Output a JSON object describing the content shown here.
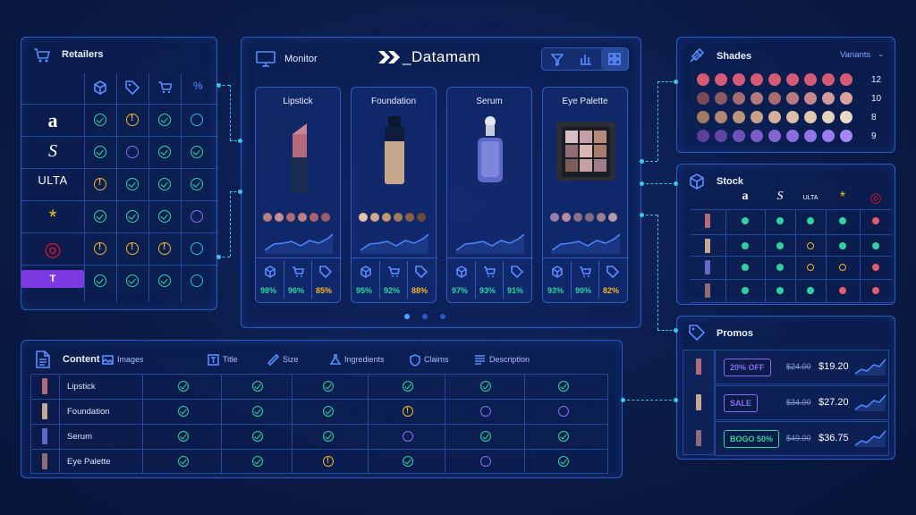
{
  "retailers": {
    "title": "Retailers",
    "headers": [
      "inventory-icon",
      "tag-icon",
      "cart-icon",
      "%"
    ],
    "rows": [
      {
        "name": "Amazon",
        "logo": "a",
        "status": [
          "ok",
          "warn",
          "ok",
          "empty"
        ]
      },
      {
        "name": "Sephora",
        "logo": "S",
        "status": [
          "ok",
          "pend",
          "ok",
          "ok"
        ]
      },
      {
        "name": "Ulta",
        "logo": "ULTA",
        "status": [
          "warn",
          "ok",
          "ok",
          "ok"
        ]
      },
      {
        "name": "Walmart",
        "logo": "*",
        "status": [
          "ok",
          "ok",
          "ok",
          "pend"
        ]
      },
      {
        "name": "Target",
        "logo": "◎",
        "status": [
          "warn",
          "warn",
          "warn",
          "empty"
        ]
      },
      {
        "name": "T",
        "logo": "T",
        "status": [
          "ok",
          "ok",
          "ok",
          "empty"
        ]
      }
    ]
  },
  "monitor": {
    "title": "Monitor",
    "brand": "_Datamam",
    "products": [
      {
        "name": "Lipstick",
        "stats": [
          "98%",
          "96%",
          "85%"
        ],
        "warn_last": true,
        "swatches": [
          "#b77f86",
          "#c48e94",
          "#b06a76",
          "#c07f8a",
          "#a9636f",
          "#9b5d68"
        ]
      },
      {
        "name": "Foundation",
        "stats": [
          "95%",
          "92%",
          "88%"
        ],
        "warn_last": true,
        "swatches": [
          "#e3c2a6",
          "#d2a88a",
          "#c4936f",
          "#a77a5c",
          "#8a5f46",
          "#6e4a38"
        ]
      },
      {
        "name": "Serum",
        "stats": [
          "97%",
          "93%",
          "91%"
        ],
        "warn_last": false,
        "swatches": []
      },
      {
        "name": "Eye Palette",
        "stats": [
          "93%",
          "90%",
          "82%"
        ],
        "warn_last": true,
        "swatches": [
          "#9b7fa5",
          "#b28ea8",
          "#8d6f86",
          "#7f6a84",
          "#9f7f8e",
          "#b59ba3"
        ]
      }
    ]
  },
  "shades": {
    "title": "Shades",
    "dropdown": "Variants",
    "rows": [
      {
        "count": "12",
        "colors": [
          "#d45a76",
          "#d45a76",
          "#d45a76",
          "#d45a76",
          "#d45a76",
          "#d45a76",
          "#d45a76",
          "#d45a76",
          "#d45a76"
        ]
      },
      {
        "count": "10",
        "colors": [
          "#7d4a57",
          "#8c5a62",
          "#a26c70",
          "#b3787b",
          "#a86b6e",
          "#b97c7e",
          "#c7888b",
          "#d19a9b",
          "#d8a2a3"
        ]
      },
      {
        "count": "8",
        "colors": [
          "#a37a66",
          "#b08774",
          "#bd957f",
          "#c9a28a",
          "#d6b199",
          "#ddbfa8",
          "#e2c7b1",
          "#e8d3bf",
          "#ecdac8"
        ]
      },
      {
        "count": "9",
        "colors": [
          "#5a3f9b",
          "#6345a8",
          "#6f4fb8",
          "#7c5bc8",
          "#8463d2",
          "#8d6be0",
          "#8f73ea",
          "#9a7cf0",
          "#a487f2"
        ]
      }
    ]
  },
  "stock": {
    "title": "Stock",
    "rows": [
      [
        "#2ed3a0",
        "#2ed3a0",
        "#2ed3a0",
        "#2ed3a0",
        "#e85b6a"
      ],
      [
        "#2ed3a0",
        "#2ed3a0",
        "ring-yellow",
        "#2ed3a0",
        "#2ed3a0"
      ],
      [
        "#2ed3a0",
        "#2ed3a0",
        "ring-yellow",
        "ring-yellow",
        "#e85b6a"
      ],
      [
        "#2ed3a0",
        "#2ed3a0",
        "#2ed3a0",
        "#e85b6a",
        "#e85b6a"
      ]
    ]
  },
  "promos": {
    "title": "Promos",
    "items": [
      {
        "badge": "20% OFF",
        "old": "$24.00",
        "new": "$19.20",
        "color": "#8e6bf2"
      },
      {
        "badge": "SALE",
        "old": "$34.00",
        "new": "$27.20",
        "color": "#8e6bf2"
      },
      {
        "badge": "BOGO 50%",
        "old": "$49.00",
        "new": "$36.75",
        "color": "#2ed3a0"
      }
    ]
  },
  "content": {
    "title": "Content",
    "columns": [
      "Images",
      "Title",
      "Size",
      "Ingredients",
      "Claims",
      "Description"
    ],
    "rows": [
      {
        "name": "Lipstick",
        "status": [
          "ok",
          "ok",
          "ok",
          "ok",
          "ok",
          "ok"
        ]
      },
      {
        "name": "Foundation",
        "status": [
          "ok",
          "ok",
          "ok",
          "warn",
          "pend",
          "pend"
        ]
      },
      {
        "name": "Serum",
        "status": [
          "ok",
          "ok",
          "ok",
          "pend",
          "ok",
          "ok"
        ]
      },
      {
        "name": "Eye Palette",
        "status": [
          "ok",
          "ok",
          "warn",
          "ok",
          "pend",
          "ok"
        ]
      }
    ]
  }
}
